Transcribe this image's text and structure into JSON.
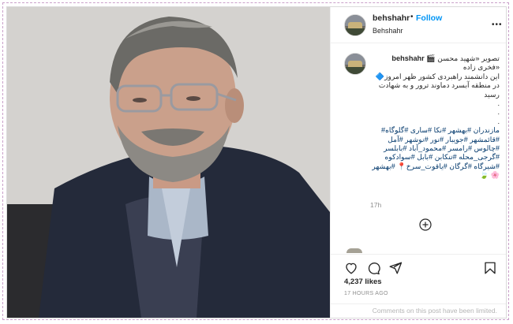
{
  "post": {
    "username": "behshahr",
    "follow_label": "Follow",
    "location": "Behshahr",
    "caption_username": "behshahr",
    "caption_lines": [
      "تصویر «شهید محسن 🎬",
      "«فخری زاده",
      "این دانشمند راهبردی کشور ظهر امروز🔷",
      "در منطقه آبسرد دماوند ترور و به شهادت",
      "رسید",
      ".",
      ".",
      "."
    ],
    "hashtag_lines": [
      "مازندران #بهشهر #نکا #ساری #گلوگاه#",
      "#قائمشهر #جویبار #نور #نوشهر #آمل",
      "#چالوس #رامسر #محمود_آباد #بابلسر",
      "#گرجی_محله #تنکابن #بابل #سوادکوه",
      "#شیرگاه #گرگان #یاقوت_سرخ📍 #بهشهر",
      "🌸 🍃"
    ],
    "time_ago": "17h",
    "likes": "4,237 likes",
    "posted_ago": "17 HOURS AGO",
    "comments_notice": "Comments on this post have been limited."
  },
  "icons": [
    "heart-icon",
    "comment-icon",
    "share-icon",
    "bookmark-icon",
    "add-circle-icon",
    "more-icon"
  ],
  "colors": {
    "follow": "#0095f6",
    "hashtag": "#00376b",
    "muted": "#8e8e8e",
    "text": "#262626"
  }
}
